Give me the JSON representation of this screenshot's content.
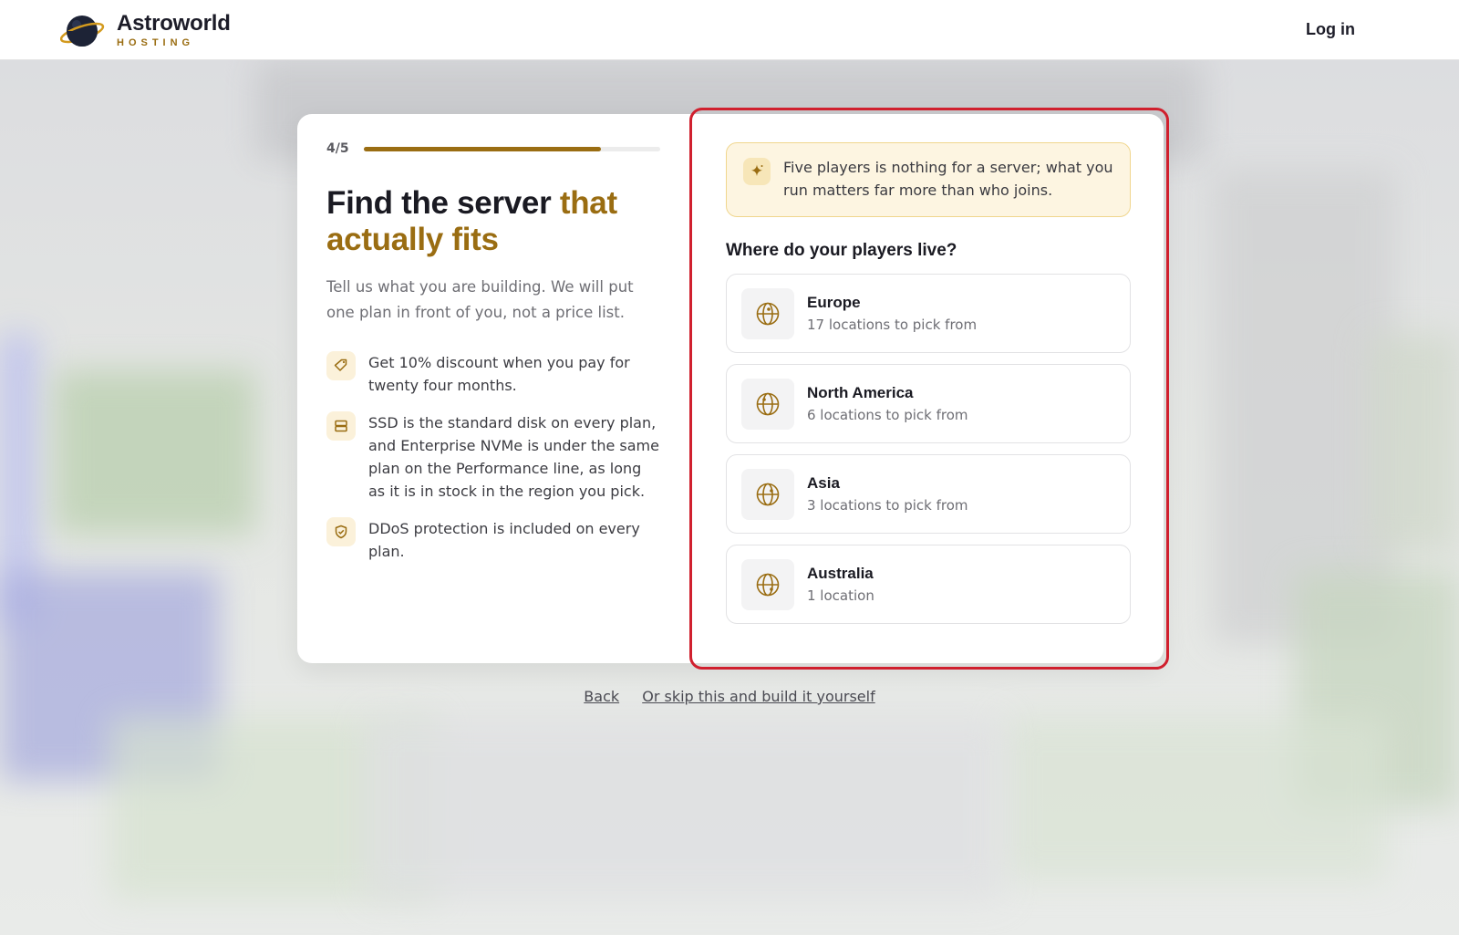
{
  "brand": {
    "name": "Astroworld",
    "sub": "HOSTING",
    "accent_color": "#9a6d12",
    "logo_icon": "planet-icon"
  },
  "header": {
    "login_label": "Log in"
  },
  "progress": {
    "step_text": "4/5",
    "fraction": 0.8
  },
  "left": {
    "title_main": "Find the server ",
    "title_accent": "that actually fits",
    "subtitle": "Tell us what you are building. We will put one plan in front of you, not a price list.",
    "features": [
      {
        "icon": "tag-icon",
        "text": "Get 10% discount when you pay for twenty four months."
      },
      {
        "icon": "disk-icon",
        "text": "SSD is the standard disk on every plan, and Enterprise NVMe is under the same plan on the Performance line, as long as it is in stock in the region you pick."
      },
      {
        "icon": "shield-icon",
        "text": "DDoS protection is included on every plan."
      }
    ]
  },
  "right": {
    "tip_icon": "sparkle-icon",
    "tip": "Five players is nothing for a server; what you run matters far more than who joins.",
    "question": "Where do your players live?",
    "options": [
      {
        "icon": "globe-icon",
        "name": "Europe",
        "sub": "17 locations to pick from"
      },
      {
        "icon": "globe-icon",
        "name": "North America",
        "sub": "6 locations to pick from"
      },
      {
        "icon": "globe-icon",
        "name": "Asia",
        "sub": "3 locations to pick from"
      },
      {
        "icon": "globe-icon",
        "name": "Australia",
        "sub": "1 location"
      }
    ]
  },
  "footer": {
    "back_label": "Back",
    "skip_label": "Or skip this and build it yourself"
  },
  "colors": {
    "highlight": "#d0202e",
    "tip_bg": "#fdf5e1",
    "tip_border": "#f0d68e"
  }
}
